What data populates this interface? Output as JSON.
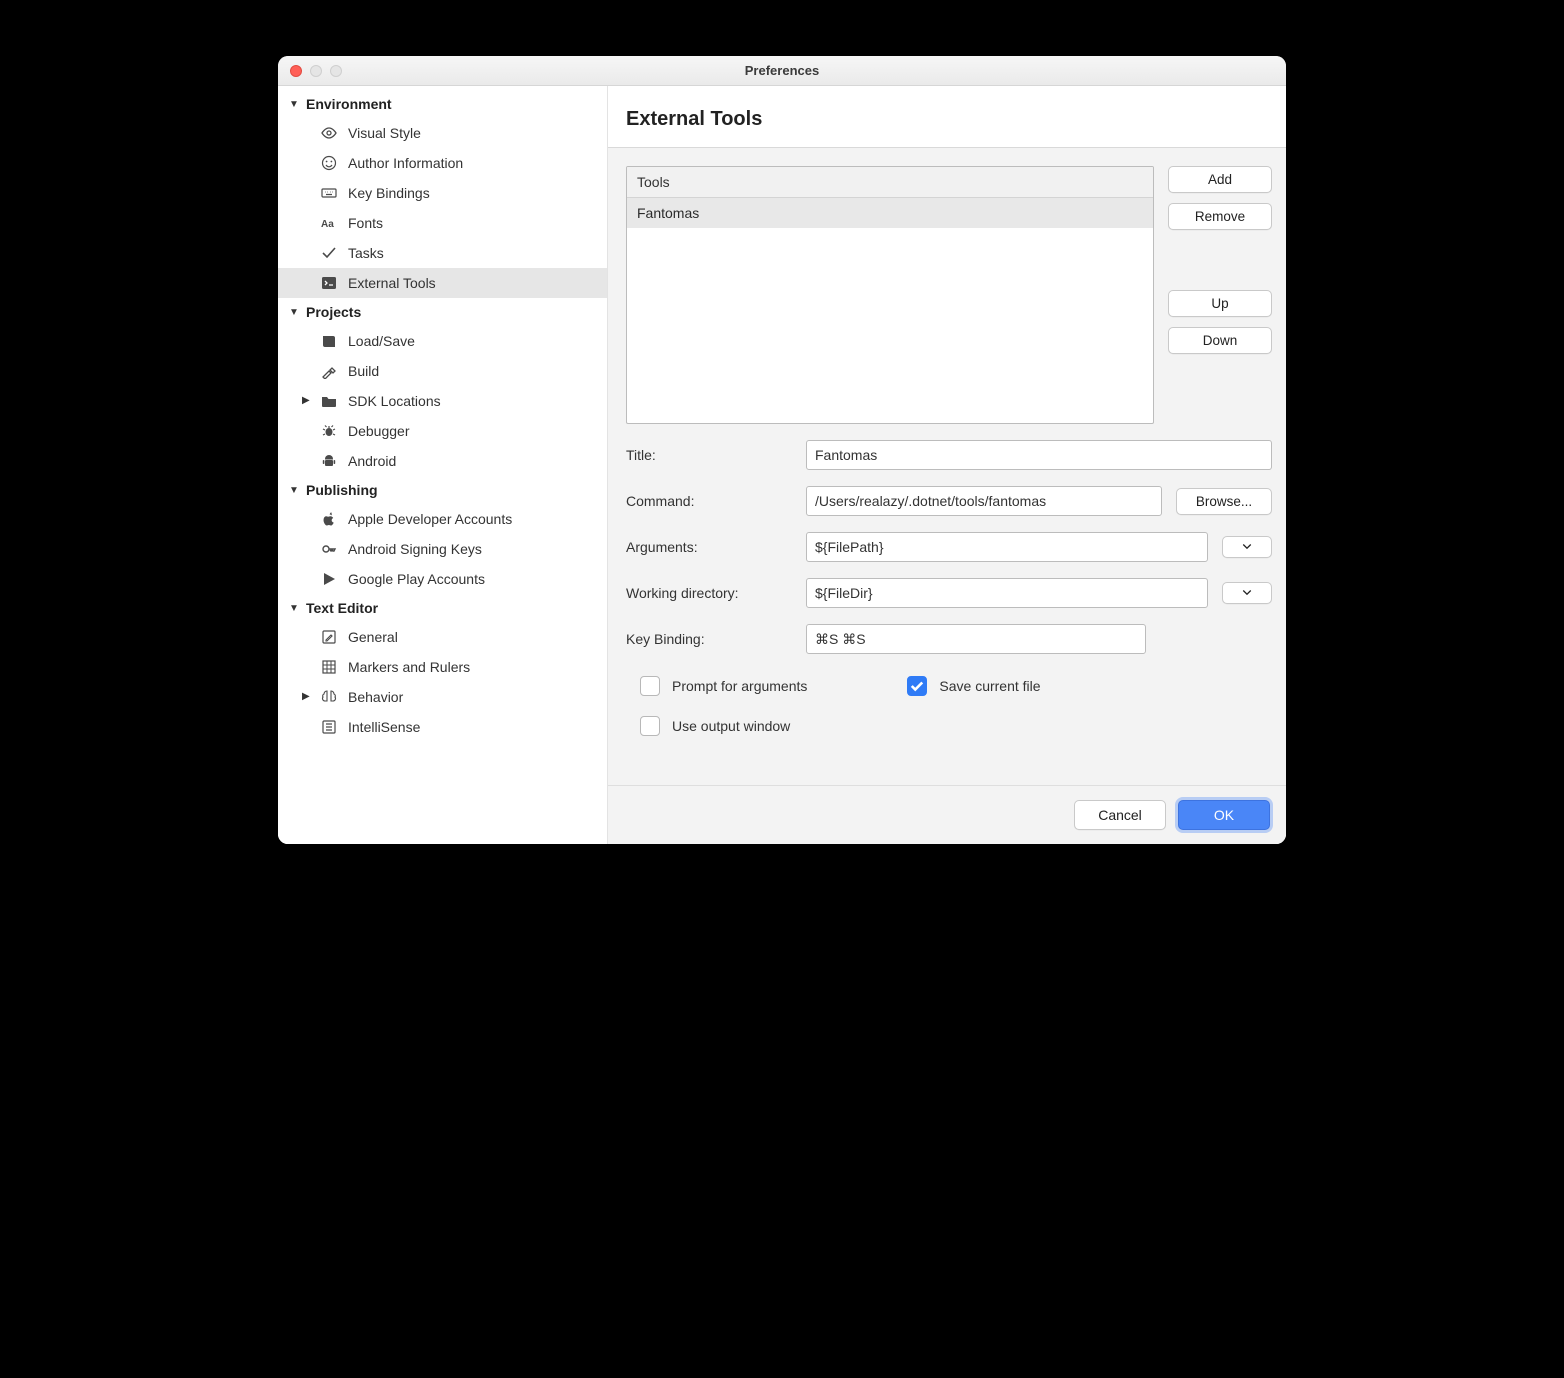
{
  "window": {
    "title": "Preferences"
  },
  "sidebar": {
    "sections": [
      {
        "label": "Environment",
        "expanded": true,
        "items": [
          {
            "key": "visual-style",
            "label": "Visual Style",
            "icon": "eye-icon"
          },
          {
            "key": "author-info",
            "label": "Author Information",
            "icon": "smile-icon"
          },
          {
            "key": "key-bindings",
            "label": "Key Bindings",
            "icon": "keyboard-icon"
          },
          {
            "key": "fonts",
            "label": "Fonts",
            "icon": "aa-icon"
          },
          {
            "key": "tasks",
            "label": "Tasks",
            "icon": "check-icon"
          },
          {
            "key": "external-tools",
            "label": "External Tools",
            "icon": "terminal-icon",
            "selected": true
          }
        ]
      },
      {
        "label": "Projects",
        "expanded": true,
        "items": [
          {
            "key": "load-save",
            "label": "Load/Save",
            "icon": "book-icon"
          },
          {
            "key": "build",
            "label": "Build",
            "icon": "hammer-icon"
          },
          {
            "key": "sdk-locations",
            "label": "SDK Locations",
            "icon": "folder-icon",
            "hasChildren": true
          },
          {
            "key": "debugger",
            "label": "Debugger",
            "icon": "bug-icon"
          },
          {
            "key": "android",
            "label": "Android",
            "icon": "android-icon"
          }
        ]
      },
      {
        "label": "Publishing",
        "expanded": true,
        "items": [
          {
            "key": "apple-dev",
            "label": "Apple Developer Accounts",
            "icon": "apple-icon"
          },
          {
            "key": "android-sign",
            "label": "Android Signing Keys",
            "icon": "key-icon"
          },
          {
            "key": "google-play",
            "label": "Google Play Accounts",
            "icon": "play-icon"
          }
        ]
      },
      {
        "label": "Text Editor",
        "expanded": true,
        "items": [
          {
            "key": "general",
            "label": "General",
            "icon": "pencil-icon"
          },
          {
            "key": "markers",
            "label": "Markers and Rulers",
            "icon": "grid-icon"
          },
          {
            "key": "behavior",
            "label": "Behavior",
            "icon": "brain-icon",
            "hasChildren": true
          },
          {
            "key": "intellisense",
            "label": "IntelliSense",
            "icon": "list-icon"
          }
        ]
      }
    ]
  },
  "content": {
    "heading": "External Tools",
    "tools_header": "Tools",
    "tools": [
      "Fantomas"
    ],
    "buttons": {
      "add": "Add",
      "remove": "Remove",
      "up": "Up",
      "down": "Down",
      "browse": "Browse..."
    },
    "labels": {
      "title": "Title:",
      "command": "Command:",
      "arguments": "Arguments:",
      "workdir": "Working directory:",
      "keybinding": "Key Binding:"
    },
    "fields": {
      "title": "Fantomas",
      "command": "/Users/realazy/.dotnet/tools/fantomas",
      "arguments": "${FilePath}",
      "workdir": "${FileDir}",
      "keybinding": "⌘S ⌘S"
    },
    "checks": {
      "prompt": {
        "label": "Prompt for arguments",
        "checked": false
      },
      "save": {
        "label": "Save current file",
        "checked": true
      },
      "output": {
        "label": "Use output window",
        "checked": false
      }
    }
  },
  "footer": {
    "cancel": "Cancel",
    "ok": "OK"
  }
}
